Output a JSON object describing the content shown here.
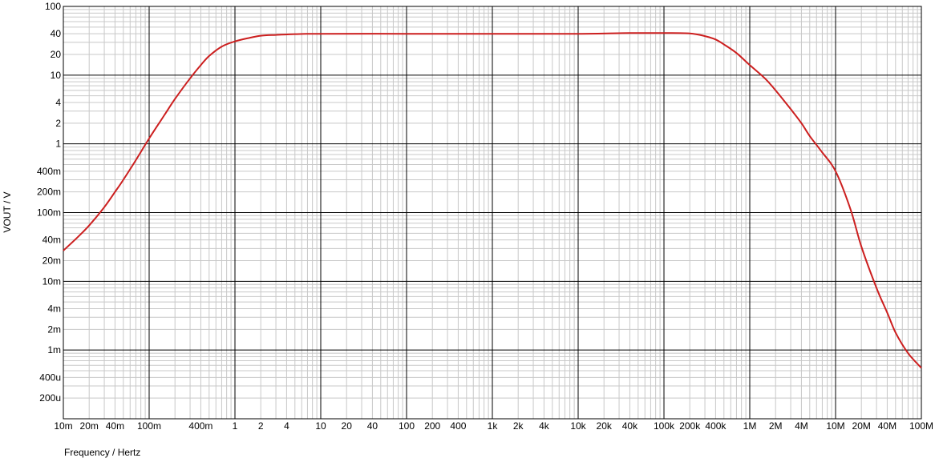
{
  "chart_data": {
    "type": "line",
    "xlabel": "Frequency / Hertz",
    "ylabel": "VOUT / V",
    "xscale": "log",
    "yscale": "log",
    "xlim": [
      0.01,
      100000000
    ],
    "ylim": [
      0.0001,
      100
    ],
    "grid": true,
    "line_color": "#cc1f1f",
    "x_tick_labels": [
      {
        "value": 0.01,
        "label": "10m"
      },
      {
        "value": 0.02,
        "label": "20m"
      },
      {
        "value": 0.04,
        "label": "40m"
      },
      {
        "value": 0.1,
        "label": "100m"
      },
      {
        "value": 0.4,
        "label": "400m"
      },
      {
        "value": 1,
        "label": "1"
      },
      {
        "value": 2,
        "label": "2"
      },
      {
        "value": 4,
        "label": "4"
      },
      {
        "value": 10,
        "label": "10"
      },
      {
        "value": 20,
        "label": "20"
      },
      {
        "value": 40,
        "label": "40"
      },
      {
        "value": 100,
        "label": "100"
      },
      {
        "value": 200,
        "label": "200"
      },
      {
        "value": 400,
        "label": "400"
      },
      {
        "value": 1000,
        "label": "1k"
      },
      {
        "value": 2000,
        "label": "2k"
      },
      {
        "value": 4000,
        "label": "4k"
      },
      {
        "value": 10000,
        "label": "10k"
      },
      {
        "value": 20000,
        "label": "20k"
      },
      {
        "value": 40000,
        "label": "40k"
      },
      {
        "value": 100000,
        "label": "100k"
      },
      {
        "value": 200000,
        "label": "200k"
      },
      {
        "value": 400000,
        "label": "400k"
      },
      {
        "value": 1000000,
        "label": "1M"
      },
      {
        "value": 2000000,
        "label": "2M"
      },
      {
        "value": 4000000,
        "label": "4M"
      },
      {
        "value": 10000000,
        "label": "10M"
      },
      {
        "value": 20000000,
        "label": "20M"
      },
      {
        "value": 40000000,
        "label": "40M"
      },
      {
        "value": 100000000,
        "label": "100M"
      }
    ],
    "y_tick_labels": [
      {
        "value": 100,
        "label": "100"
      },
      {
        "value": 40,
        "label": "40"
      },
      {
        "value": 20,
        "label": "20"
      },
      {
        "value": 10,
        "label": "10"
      },
      {
        "value": 4,
        "label": "4"
      },
      {
        "value": 2,
        "label": "2"
      },
      {
        "value": 1,
        "label": "1"
      },
      {
        "value": 0.4,
        "label": "400m"
      },
      {
        "value": 0.2,
        "label": "200m"
      },
      {
        "value": 0.1,
        "label": "100m"
      },
      {
        "value": 0.04,
        "label": "40m"
      },
      {
        "value": 0.02,
        "label": "20m"
      },
      {
        "value": 0.01,
        "label": "10m"
      },
      {
        "value": 0.004,
        "label": "4m"
      },
      {
        "value": 0.002,
        "label": "2m"
      },
      {
        "value": 0.001,
        "label": "1m"
      },
      {
        "value": 0.0004,
        "label": "400u"
      },
      {
        "value": 0.0002,
        "label": "200u"
      }
    ],
    "series": [
      {
        "x": [
          0.01,
          0.015,
          0.02,
          0.03,
          0.04,
          0.05,
          0.07,
          0.1,
          0.15,
          0.2,
          0.3,
          0.4,
          0.5,
          0.7,
          1,
          1.5,
          2,
          3,
          5,
          10,
          100,
          1000,
          10000,
          40000,
          100000,
          200000,
          300000,
          400000,
          500000,
          700000,
          1000000,
          1500000,
          2000000,
          3000000,
          4000000,
          5000000,
          7000000,
          10000000,
          15000000,
          20000000,
          30000000,
          40000000,
          50000000,
          70000000,
          100000000
        ],
        "y": [
          0.028,
          0.045,
          0.065,
          0.12,
          0.2,
          0.3,
          0.58,
          1.2,
          2.6,
          4.5,
          9,
          14,
          19,
          26,
          31,
          35,
          37.5,
          38.5,
          39.5,
          40,
          40,
          40,
          40,
          41,
          41,
          40.5,
          37,
          33,
          28,
          21,
          14,
          9,
          6,
          3.2,
          2,
          1.3,
          0.75,
          0.4,
          0.11,
          0.032,
          0.008,
          0.0035,
          0.0018,
          0.0009,
          0.00055
        ]
      }
    ]
  }
}
